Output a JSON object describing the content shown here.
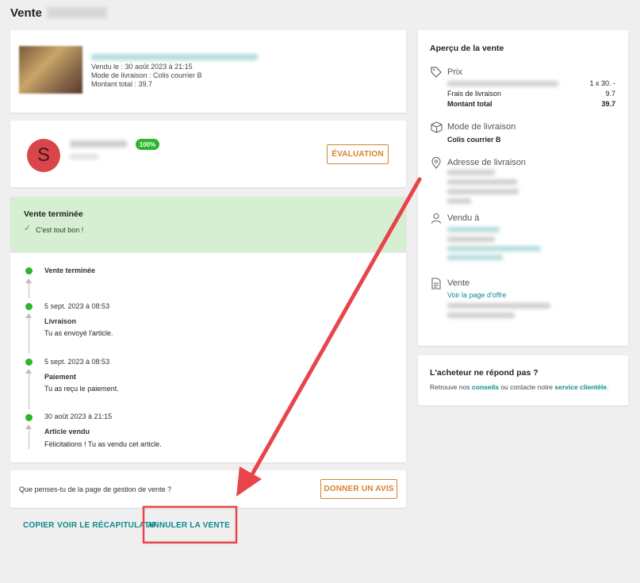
{
  "page": {
    "title": "Vente"
  },
  "item": {
    "sold_on": "Vendu le : 30 août 2023 à 21:15",
    "delivery_mode": "Mode de livraison : Colis courrier B",
    "total": "Montant total : 39.7"
  },
  "seller": {
    "avatar_letter": "S",
    "rating_badge": "100%",
    "evaluation_button": "ÉVALUATION"
  },
  "status": {
    "title": "Vente terminée",
    "message": "C'est tout bon !"
  },
  "timeline": [
    {
      "date": "",
      "label": "Vente terminée",
      "text": ""
    },
    {
      "date": "5 sept. 2023 à 08:53",
      "label": "Livraison",
      "text": "Tu as envoyé l'article."
    },
    {
      "date": "5 sept. 2023 à 08:53",
      "label": "Paiement",
      "text": "Tu as reçu le paiement."
    },
    {
      "date": "30 août 2023 à 21:15",
      "label": "Article vendu",
      "text": "Félicitations ! Tu as vendu cet article."
    }
  ],
  "feedback": {
    "question": "Que penses-tu de la page de gestion de vente ?",
    "button": "DONNER UN AVIS"
  },
  "footer_links": {
    "copy": "COPIER",
    "summary": "VOIR LE RÉCAPITULATIF",
    "cancel": "ANNULER LA VENTE"
  },
  "overview": {
    "title": "Aperçu de la vente",
    "price_header": "Prix",
    "price_qty": "1 x 30. -",
    "shipping_label": "Frais de livraison",
    "shipping_value": "9.7",
    "total_label": "Montant total",
    "total_value": "39.7",
    "delivery_header": "Mode de livraison",
    "delivery_value": "Colis courrier B",
    "address_header": "Adresse de livraison",
    "sold_to_header": "Vendu à",
    "sale_header": "Vente",
    "offer_link": "Voir la page d'offre"
  },
  "help": {
    "title": "L'acheteur ne répond pas ?",
    "text_before": "Retrouve nos ",
    "link_tips": "conseils",
    "text_middle": " ou contacte notre ",
    "link_service": "service clientèle",
    "text_after": "."
  },
  "colors": {
    "accent_orange": "#d9822b",
    "link_teal": "#0e8a8a",
    "success_green": "#2db52d",
    "status_bg": "#d6efd3",
    "annotation_red": "#e8454b"
  }
}
